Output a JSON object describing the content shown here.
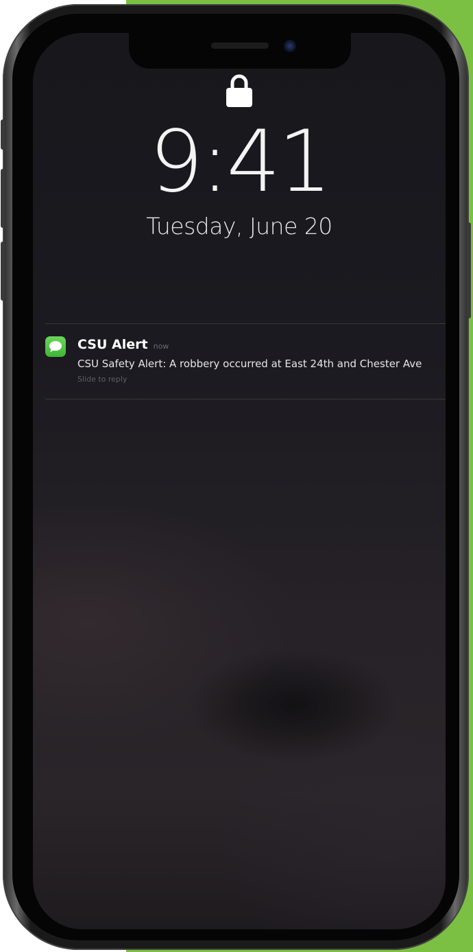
{
  "lock_screen": {
    "time": "9:41",
    "date": "Tuesday, June 20",
    "lock_icon": "lock-icon"
  },
  "notification": {
    "app_icon": "messages-icon",
    "title": "CSU Alert",
    "timestamp": "now",
    "body": "CSU Safety Alert: A robbery occurred at East 24th and Chester Ave",
    "action_hint": "Slide to reply"
  },
  "colors": {
    "backdrop": "#7bc043",
    "messages_icon": "#4cc240"
  }
}
